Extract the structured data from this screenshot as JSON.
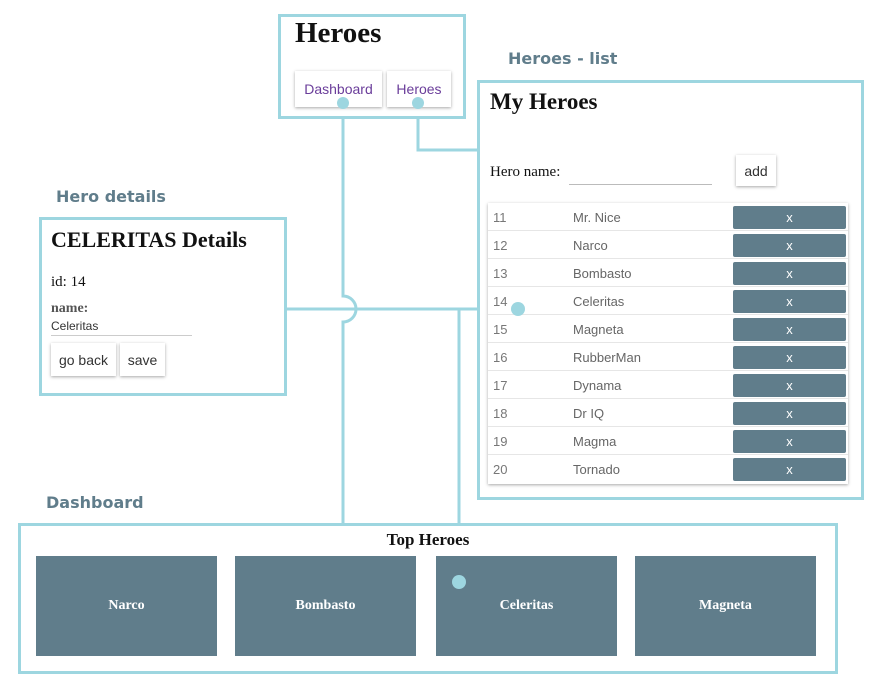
{
  "labels": {
    "heroes_list": "Heroes - list",
    "hero_details": "Hero details",
    "dashboard": "Dashboard"
  },
  "app_shell": {
    "title": "Heroes",
    "nav": [
      "Dashboard",
      "Heroes"
    ]
  },
  "hero_list": {
    "title": "My Heroes",
    "input_label": "Hero name:",
    "add_label": "add",
    "delete_label": "x",
    "heroes": [
      {
        "id": "11",
        "name": "Mr. Nice"
      },
      {
        "id": "12",
        "name": "Narco"
      },
      {
        "id": "13",
        "name": "Bombasto"
      },
      {
        "id": "14",
        "name": "Celeritas"
      },
      {
        "id": "15",
        "name": "Magneta"
      },
      {
        "id": "16",
        "name": "RubberMan"
      },
      {
        "id": "17",
        "name": "Dynama"
      },
      {
        "id": "18",
        "name": "Dr IQ"
      },
      {
        "id": "19",
        "name": "Magma"
      },
      {
        "id": "20",
        "name": "Tornado"
      }
    ]
  },
  "hero_details": {
    "title": "CELERITAS Details",
    "id_text": "id: 14",
    "name_label": "name:",
    "name_value": "Celeritas",
    "back_label": "go back",
    "save_label": "save"
  },
  "dashboard": {
    "title": "Top Heroes",
    "tiles": [
      "Narco",
      "Bombasto",
      "Celeritas",
      "Magneta"
    ]
  },
  "colors": {
    "frame": "#9dd6e0",
    "label": "#607d8b",
    "tile": "#607d8b",
    "nav_text": "#6a3d9a"
  }
}
